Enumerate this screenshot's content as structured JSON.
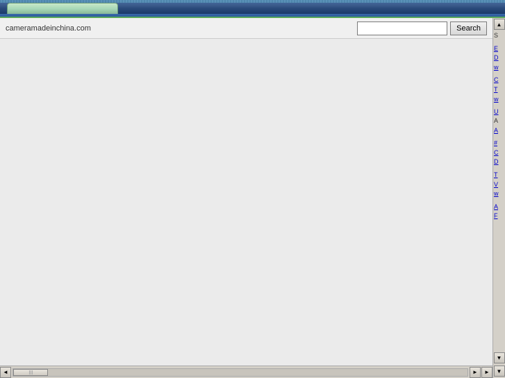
{
  "header": {
    "tab_label": "",
    "site_name": "cameramadeinchina.com",
    "search_placeholder": "",
    "search_button_label": "Search"
  },
  "sidebar": {
    "scroll_up": "▲",
    "scroll_down": "▼",
    "link_groups": [
      {
        "id": "group1",
        "links": [
          {
            "label": "S",
            "type": "text"
          },
          {
            "label": "E",
            "type": "link"
          },
          {
            "label": "D",
            "type": "link"
          },
          {
            "label": "w",
            "type": "link"
          }
        ]
      },
      {
        "id": "group2",
        "links": [
          {
            "label": "C",
            "type": "link"
          },
          {
            "label": "T",
            "type": "link"
          },
          {
            "label": "w",
            "type": "link"
          }
        ]
      },
      {
        "id": "group3",
        "links": [
          {
            "label": "U",
            "type": "link"
          },
          {
            "label": "A",
            "type": "text"
          },
          {
            "label": "A",
            "type": "link"
          }
        ]
      },
      {
        "id": "group4",
        "links": [
          {
            "label": "#",
            "type": "link"
          },
          {
            "label": "C",
            "type": "link"
          },
          {
            "label": "D",
            "type": "link"
          }
        ]
      },
      {
        "id": "group5",
        "links": [
          {
            "label": "T",
            "type": "link"
          },
          {
            "label": "V",
            "type": "link"
          },
          {
            "label": "w",
            "type": "link"
          }
        ]
      },
      {
        "id": "group6",
        "links": [
          {
            "label": "A",
            "type": "link"
          },
          {
            "label": "F",
            "type": "link"
          }
        ]
      }
    ]
  },
  "scrollbar": {
    "left_arrow": "◄",
    "right_arrow": "►",
    "up_arrow": "▲",
    "down_arrow": "▼"
  },
  "status": {
    "text": ""
  }
}
